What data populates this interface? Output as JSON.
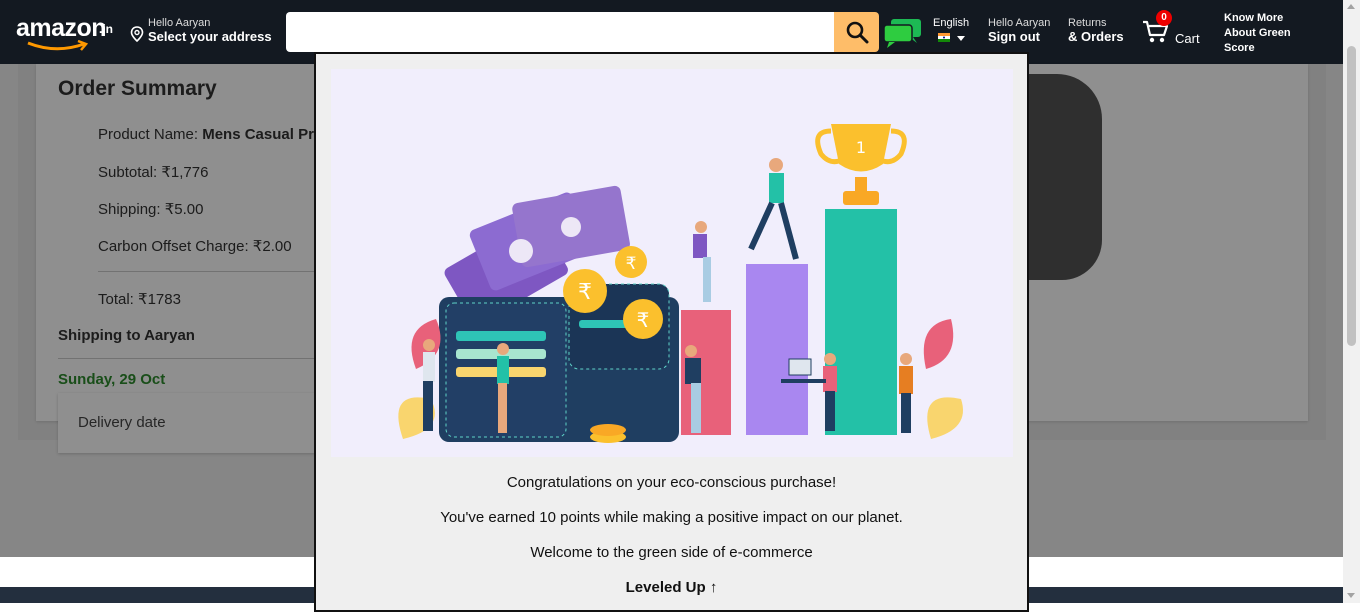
{
  "header": {
    "logo_text": "amazon",
    "logo_tld": ".in",
    "address_greeting": "Hello Aaryan",
    "address_action": "Select your address",
    "search_placeholder": "",
    "language": "English",
    "account_greeting": "Hello Aaryan",
    "account_action": "Sign out",
    "returns_label": "Returns",
    "orders_label": "& Orders",
    "cart_count": "0",
    "cart_label": "Cart",
    "green_score_line1": "Know More",
    "green_score_line2": "About Green",
    "green_score_line3": "Score"
  },
  "order_summary": {
    "title": "Order Summary",
    "product_label": "Product Name:",
    "product_name": "Mens Casual Pre",
    "subtotal": "Subtotal: ₹1,776",
    "shipping": "Shipping: ₹5.00",
    "carbon_offset": "Carbon Offset Charge: ₹2.00",
    "total": "Total: ₹1783",
    "shipping_to": "Shipping to Aaryan",
    "delivery_day": "Sunday, 29 Oct",
    "delivery_date_label": "Delivery date"
  },
  "modal": {
    "message_1": "Congratulations on your eco-conscious purchase!",
    "message_2": "You've earned 10 points while making a positive impact on our planet.",
    "message_3": "Welcome to the green side of e-commerce",
    "level_up": "Leveled Up ↑",
    "trophy_number": "1",
    "coin_symbol": "₹"
  },
  "colors": {
    "header_bg": "#131921",
    "search_button": "#febd69",
    "cart_badge": "#ee0000",
    "delivery_green": "#2e8b2e",
    "modal_bg": "#efefef",
    "illustration_bg": "#f1eefc"
  },
  "icons": [
    "location-pin-icon",
    "search-icon",
    "chat-icon",
    "india-flag-icon",
    "cart-icon"
  ]
}
